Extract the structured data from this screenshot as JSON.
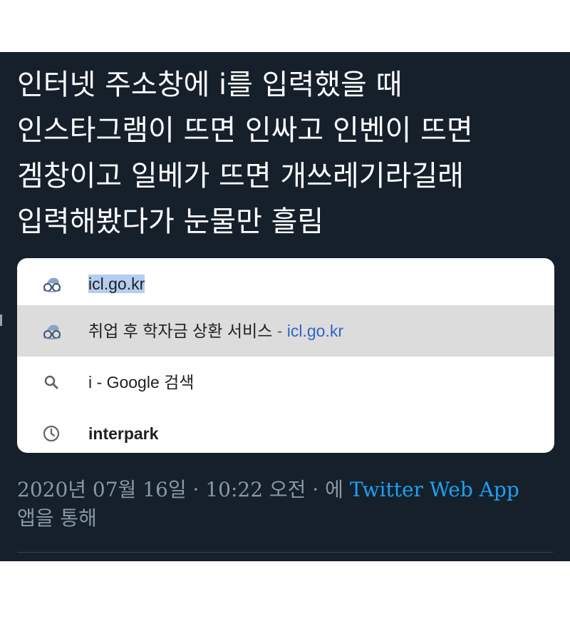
{
  "tweet": {
    "text": "인터넷 주소창에 i를 입력했을 때\n인스타그램이 뜨면 인싸고 인벤이 뜨면\n겜창이고 일베가 뜨면 개쓰레기라길래\n입력해봤다가 눈물만 흘림"
  },
  "omnibox": {
    "suggestions": [
      {
        "icon": "site-favicon-icon",
        "highlighted": "icl.go.kr"
      },
      {
        "icon": "site-favicon-icon",
        "title": "취업 후 학자금 상환 서비스",
        "separator": "-",
        "url": "icl.go.kr"
      },
      {
        "icon": "search-icon",
        "query": "i",
        "separator": "-",
        "engine_text": "Google 검색"
      },
      {
        "icon": "history-clock-icon",
        "text": "interpark"
      }
    ]
  },
  "meta": {
    "date": "2020년 07월 16일",
    "dot1": "·",
    "time": "10:22 오전",
    "dot2": "·",
    "prefix": "에",
    "app": "Twitter Web App",
    "suffix": "앱을 통해"
  },
  "colors": {
    "card_bg": "#15202b",
    "link": "#1da1f2",
    "selected_row": "#dcdcdc",
    "url_blue": "#3162c6"
  }
}
